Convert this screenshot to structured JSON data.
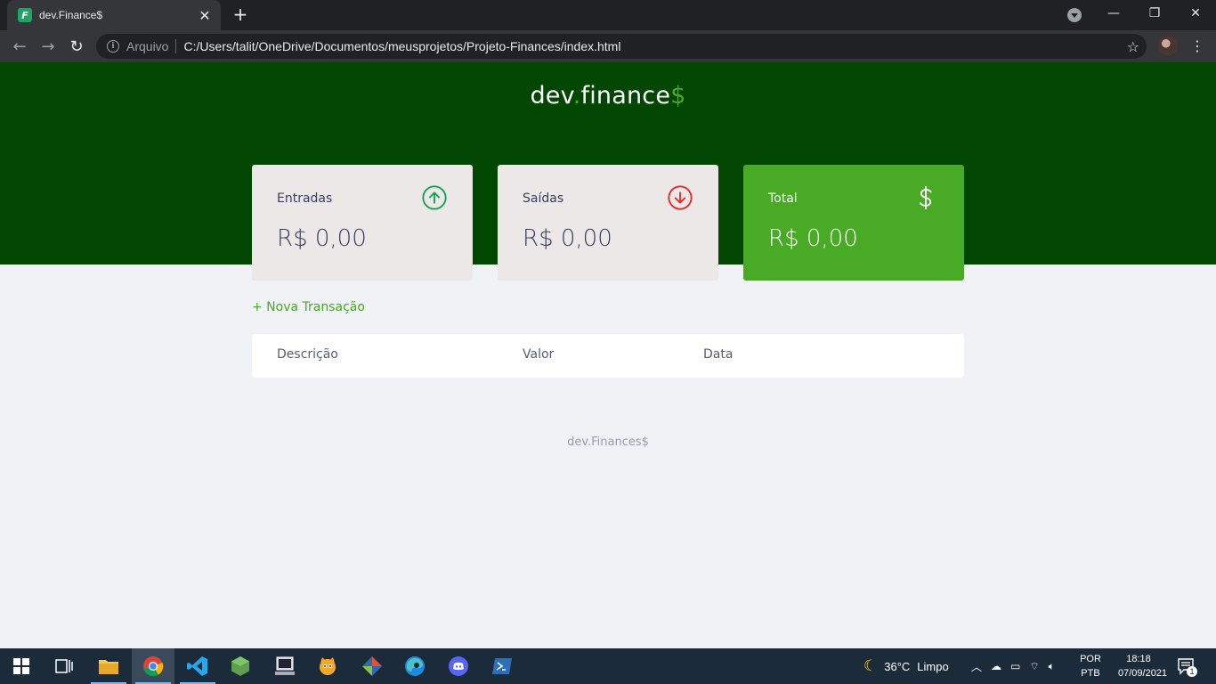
{
  "browser": {
    "tab_title": "dev.Finance$",
    "favicon_letter": "F",
    "scheme_label": "Arquivo",
    "url": "C:/Users/talit/OneDrive/Documentos/meusprojetos/Projeto-Finances/index.html",
    "icons": [
      "back-icon",
      "forward-icon",
      "reload-icon",
      "info-icon",
      "star-icon",
      "profile-avatar",
      "menu-icon",
      "new-tab-icon",
      "close-icon",
      "minimize-icon",
      "maximize-icon"
    ]
  },
  "app": {
    "logo": {
      "part1": "dev",
      "dot": ".",
      "part2": "finance",
      "dollar": "$"
    },
    "cards": {
      "income": {
        "label": "Entradas",
        "value": "R$ 0,00",
        "icon": "arrow-up-circle-icon",
        "icon_color": "#12a454"
      },
      "expense": {
        "label": "Saídas",
        "value": "R$ 0,00",
        "icon": "arrow-down-circle-icon",
        "icon_color": "#e92929"
      },
      "total": {
        "label": "Total",
        "value": "R$ 0,00",
        "icon": "dollar-icon",
        "bg_color": "#49aa26"
      }
    },
    "new_transaction": "+ Nova Transação",
    "table": {
      "headers": [
        "Descrição",
        "Valor",
        "Data"
      ]
    },
    "footer": "dev.Finances$",
    "colors": {
      "header_bg": "#014601",
      "accent": "#49aa26",
      "page_bg": "#f0f2f5",
      "text": "#363f5f"
    }
  },
  "taskbar": {
    "weather": {
      "temp": "36°C",
      "condition": "Limpo"
    },
    "lang": {
      "line1": "POR",
      "line2": "PTB"
    },
    "clock": {
      "time": "18:18",
      "date": "07/09/2021"
    },
    "notifications": "1",
    "apps": [
      "start-icon",
      "task-view-icon",
      "file-explorer-icon",
      "chrome-icon",
      "vscode-icon",
      "node-icon",
      "terminal-icon",
      "scratch-icon",
      "git-icon",
      "edge-icon",
      "discord-icon",
      "powershell-icon"
    ]
  }
}
